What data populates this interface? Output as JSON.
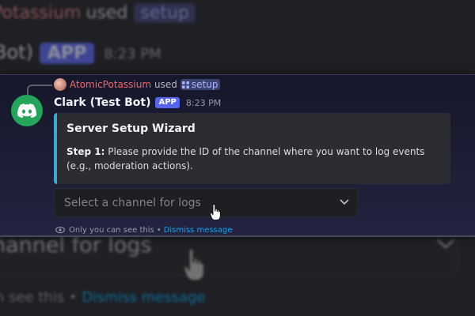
{
  "reference": {
    "username": "AtomicPotassium",
    "used_text": "used",
    "command": "setup"
  },
  "message": {
    "author": "Clark (Test Bot)",
    "app_badge": "APP",
    "timestamp": "8:23 PM"
  },
  "embed": {
    "title": "Server Setup Wizard",
    "step_label": "Step 1:",
    "step_text": " Please provide the ID of the channel where you want to log events (e.g., moderation actions)."
  },
  "select": {
    "placeholder": "Select a channel for logs"
  },
  "footer": {
    "notice": "Only you can see this",
    "separator": "•",
    "dismiss": "Dismiss message"
  },
  "background": {
    "row1_user": "Potassium",
    "row1_used": "used",
    "row1_cmd": "setup",
    "row2_name": "Bot)",
    "row2_badge": "APP",
    "row2_time": "8:23 PM",
    "row3_text": "hannel for logs",
    "row4_text": "n see this",
    "row4_sep": "•",
    "row4_link": "Dismiss message"
  },
  "colors": {
    "accent": "#5865f2",
    "embed_border": "#3ba9d6",
    "username": "#f0686e",
    "link": "#00a8fc",
    "bot_avatar": "#23a55a"
  },
  "icons": [
    "slash-command-icon",
    "discord-logo-icon",
    "chevron-down-icon",
    "eye-icon",
    "hand-cursor-icon"
  ]
}
